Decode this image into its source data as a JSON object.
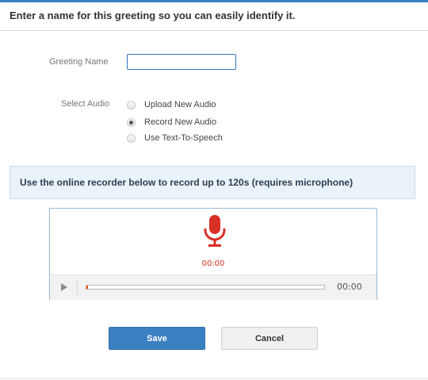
{
  "header": {
    "title": "Enter a name for this greeting so you can easily identify it."
  },
  "form": {
    "greeting_name_label": "Greeting Name",
    "greeting_name_value": "",
    "select_audio_label": "Select Audio",
    "audio_options": [
      {
        "label": "Upload New Audio",
        "checked": false
      },
      {
        "label": "Record New Audio",
        "checked": true
      },
      {
        "label": "Use Text-To-Speech",
        "checked": false
      }
    ]
  },
  "info": {
    "text": "Use the online recorder below to record up to 120s (requires microphone)"
  },
  "recorder": {
    "mic_icon": "microphone-icon",
    "mic_color": "#d93025",
    "record_time": "00:00",
    "play_icon": "play-icon",
    "player_time": "00:00",
    "progress": 0
  },
  "actions": {
    "save_label": "Save",
    "cancel_label": "Cancel"
  },
  "colors": {
    "accent": "#3a80c3",
    "info_bg": "#eaf2fa"
  }
}
